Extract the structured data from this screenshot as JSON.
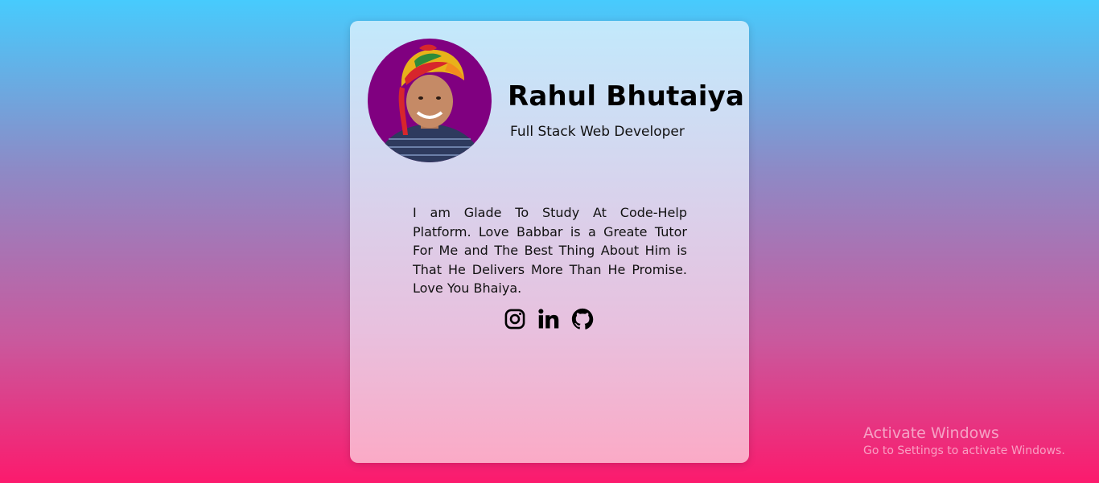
{
  "profile": {
    "name": "Rahul Bhutaiya",
    "role": "Full Stack Web Developer",
    "bio": "I am Glade To Study At Code-Help Platform. Love Babbar is a Greate Tutor For Me and The Best Thing About Him is That He Delivers More Than He Promise. Love You Bhaiya."
  },
  "social": [
    {
      "icon": "instagram-icon"
    },
    {
      "icon": "linkedin-icon"
    },
    {
      "icon": "github-icon"
    }
  ],
  "watermark": {
    "title": "Activate Windows",
    "subtitle": "Go to Settings to activate Windows."
  },
  "colors": {
    "background_top": "#47cbfd",
    "background_bottom": "#fc1a6d",
    "avatar_ring": "#800080"
  }
}
